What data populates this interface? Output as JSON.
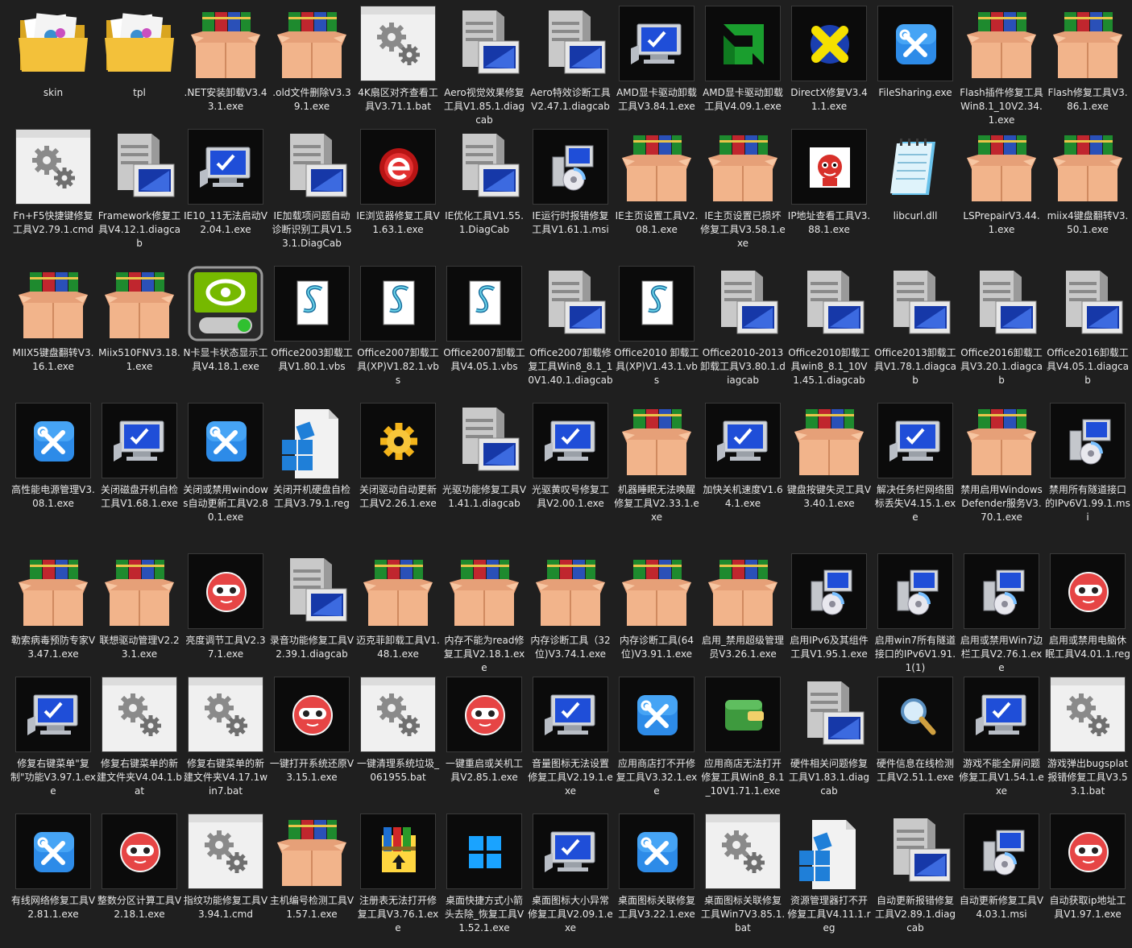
{
  "theme": {
    "background": "#1f1f1f",
    "text": "#e8e8e8",
    "thumb_border": "#3a3a3a"
  },
  "files": [
    {
      "name": "skin",
      "icon": "folder-icon"
    },
    {
      "name": "tpl",
      "icon": "folder-icon"
    },
    {
      "name": ".NET安装卸载V3.43.1.exe",
      "icon": "package-box-icon"
    },
    {
      "name": ".old文件删除V3.39.1.exe",
      "icon": "package-box-icon"
    },
    {
      "name": "4K扇区对齐查看工具V3.71.1.bat",
      "icon": "gear-window-icon"
    },
    {
      "name": "Aero视觉效果修复工具V1.85.1.diagcab",
      "icon": "server-icon"
    },
    {
      "name": "Aero特效诊断工具V2.47.1.diagcab",
      "icon": "server-icon"
    },
    {
      "name": "AMD显卡驱动卸载工具V3.84.1.exe",
      "icon": "monitor-check-icon"
    },
    {
      "name": "AMD显卡驱动卸载工具V4.09.1.exe",
      "icon": "amd-logo-icon"
    },
    {
      "name": "DirectX修复V3.41.1.exe",
      "icon": "directx-icon"
    },
    {
      "name": "FileSharing.exe",
      "icon": "tools-icon"
    },
    {
      "name": "Flash插件修复工具Win8.1_10V2.34.1.exe",
      "icon": "package-box-icon"
    },
    {
      "name": "Flash修复工具V3.86.1.exe",
      "icon": "package-box-icon"
    },
    {
      "name": "Fn+F5快捷键修复工具V2.79.1.cmd",
      "icon": "gear-window-icon"
    },
    {
      "name": "Framework修复工具V4.12.1.diagcab",
      "icon": "server-icon"
    },
    {
      "name": "IE10_11无法启动V2.04.1.exe",
      "icon": "monitor-check-icon"
    },
    {
      "name": "IE加载项问题自动诊断识别工具V1.53.1.DiagCab",
      "icon": "server-icon"
    },
    {
      "name": "IE浏览器修复工具V1.63.1.exe",
      "icon": "red-e-icon"
    },
    {
      "name": "IE优化工具V1.55.1.DiagCab",
      "icon": "server-icon"
    },
    {
      "name": "IE运行时报错修复工具V1.61.1.msi",
      "icon": "installer-icon"
    },
    {
      "name": "IE主页设置工具V2.08.1.exe",
      "icon": "package-box-icon"
    },
    {
      "name": "IE主页设置已损坏修复工具V3.58.1.exe",
      "icon": "package-box-icon"
    },
    {
      "name": "IP地址查看工具V3.88.1.exe",
      "icon": "mascot-icon"
    },
    {
      "name": "libcurl.dll",
      "icon": "notepad-icon"
    },
    {
      "name": "LSPrepairV3.44.1.exe",
      "icon": "package-box-icon"
    },
    {
      "name": "miix4键盘翻转V3.50.1.exe",
      "icon": "package-box-icon"
    },
    {
      "name": "MIIX5键盘翻转V3.16.1.exe",
      "icon": "package-box-icon"
    },
    {
      "name": "Miix510FNV3.18.1.exe",
      "icon": "package-box-icon"
    },
    {
      "name": "N卡显卡状态显示工具V4.18.1.exe",
      "icon": "nvidia-icon"
    },
    {
      "name": "Office2003卸载工具V1.80.1.vbs",
      "icon": "script-icon"
    },
    {
      "name": "Office2007卸载工具(XP)V1.82.1.vbs",
      "icon": "script-icon"
    },
    {
      "name": "Office2007卸载工具V4.05.1.vbs",
      "icon": "script-icon"
    },
    {
      "name": "Office2007卸载修复工具Win8_8.1_10V1.40.1.diagcab",
      "icon": "server-icon"
    },
    {
      "name": "Office2010 卸载工具(XP)V1.43.1.vbs",
      "icon": "script-icon"
    },
    {
      "name": "Office2010-2013卸载工具V3.80.1.diagcab",
      "icon": "server-icon"
    },
    {
      "name": "Office2010卸载工具win8_8.1_10V1.45.1.diagcab",
      "icon": "server-icon"
    },
    {
      "name": "Office2013卸载工具V1.78.1.diagcab",
      "icon": "server-icon"
    },
    {
      "name": "Office2016卸载工具V3.20.1.diagcab",
      "icon": "server-icon"
    },
    {
      "name": "Office2016卸载工具V4.05.1.diagcab",
      "icon": "server-icon"
    },
    {
      "name": "高性能电源管理V3.08.1.exe",
      "icon": "tools-icon"
    },
    {
      "name": "关闭磁盘开机自检工具V1.68.1.exe",
      "icon": "monitor-check-icon"
    },
    {
      "name": "关闭或禁用windows自动更新工具V2.80.1.exe",
      "icon": "tools-icon"
    },
    {
      "name": "关闭开机硬盘自检工具V3.79.1.reg",
      "icon": "registry-icon"
    },
    {
      "name": "关闭驱动自动更新工具V2.26.1.exe",
      "icon": "yellow-gear-icon"
    },
    {
      "name": "光驱功能修复工具V1.41.1.diagcab",
      "icon": "server-icon"
    },
    {
      "name": "光驱黄叹号修复工具V2.00.1.exe",
      "icon": "monitor-check-icon"
    },
    {
      "name": "机器睡眠无法唤醒修复工具V2.33.1.exe",
      "icon": "package-box-icon"
    },
    {
      "name": "加快关机速度V1.64.1.exe",
      "icon": "monitor-check-icon"
    },
    {
      "name": "键盘按键失灵工具V3.40.1.exe",
      "icon": "package-box-icon"
    },
    {
      "name": "解决任务栏网络图标丢失V4.15.1.exe",
      "icon": "monitor-check-icon"
    },
    {
      "name": "禁用启用Windows Defender服务V3.70.1.exe",
      "icon": "package-box-icon"
    },
    {
      "name": "禁用所有隧道接口的IPv6V1.99.1.msi",
      "icon": "installer-icon"
    },
    {
      "name": "勒索病毒预防专家V3.47.1.exe",
      "icon": "package-box-icon"
    },
    {
      "name": "联想驱动管理V2.23.1.exe",
      "icon": "package-box-icon"
    },
    {
      "name": "亮度调节工具V2.37.1.exe",
      "icon": "red-mascot-icon"
    },
    {
      "name": "录音功能修复工具V2.39.1.diagcab",
      "icon": "server-icon"
    },
    {
      "name": "迈克菲卸载工具V1.48.1.exe",
      "icon": "package-box-icon"
    },
    {
      "name": "内存不能为read修复工具V2.18.1.exe",
      "icon": "package-box-icon"
    },
    {
      "name": "内存诊断工具（32位)V3.74.1.exe",
      "icon": "package-box-icon"
    },
    {
      "name": "内存诊断工具(64位)V3.91.1.exe",
      "icon": "package-box-icon"
    },
    {
      "name": "启用_禁用超级管理员V3.26.1.exe",
      "icon": "package-box-icon"
    },
    {
      "name": "启用IPv6及其组件工具V1.95.1.exe",
      "icon": "installer-icon"
    },
    {
      "name": "启用win7所有隧道接口的IPv6V1.91.1(1)",
      "icon": "installer-icon"
    },
    {
      "name": "启用或禁用Win7边栏工具V2.76.1.exe",
      "icon": "installer-icon"
    },
    {
      "name": "启用或禁用电脑休眠工具V4.01.1.reg",
      "icon": "red-mascot-icon"
    },
    {
      "name": "修复右键菜单\"复制\"功能V3.97.1.exe",
      "icon": "monitor-check-icon"
    },
    {
      "name": "修复右键菜单的新建文件夹V4.04.1.bat",
      "icon": "gear-window-icon"
    },
    {
      "name": "修复右键菜单的新建文件夹V4.17.1win7.bat",
      "icon": "gear-window-icon"
    },
    {
      "name": "一键打开系统还原V3.15.1.exe",
      "icon": "red-mascot-icon"
    },
    {
      "name": "一键清理系统垃圾_061955.bat",
      "icon": "gear-window-icon"
    },
    {
      "name": "一键重启或关机工具V2.85.1.exe",
      "icon": "red-mascot-icon"
    },
    {
      "name": "音量图标无法设置修复工具V2.19.1.exe",
      "icon": "monitor-check-icon"
    },
    {
      "name": "应用商店打不开修复工具V3.32.1.exe",
      "icon": "tools-icon"
    },
    {
      "name": "应用商店无法打开修复工具Win8_8.1_10V1.71.1.exe",
      "icon": "wallet-icon"
    },
    {
      "name": "硬件相关问题修复工具V1.83.1.diagcab",
      "icon": "server-icon"
    },
    {
      "name": "硬件信息在线检测工具V2.51.1.exe",
      "icon": "magnifier-icon"
    },
    {
      "name": "游戏不能全屏问题修复工具V1.54.1.exe",
      "icon": "monitor-check-icon"
    },
    {
      "name": "游戏弹出bugsplat报错修复工具V3.53.1.bat",
      "icon": "gear-window-icon"
    },
    {
      "name": "有线网络修复工具V2.81.1.exe",
      "icon": "tools-icon"
    },
    {
      "name": "整数分区计算工具V2.18.1.exe",
      "icon": "red-mascot-icon"
    },
    {
      "name": "指纹功能修复工具V3.94.1.cmd",
      "icon": "gear-window-icon"
    },
    {
      "name": "主机编号检测工具V1.57.1.exe",
      "icon": "package-box-icon"
    },
    {
      "name": "注册表无法打开修复工具V3.76.1.exe",
      "icon": "archive-icon"
    },
    {
      "name": "桌面快捷方式小箭头去除_恢复工具V1.52.1.exe",
      "icon": "windows-logo-icon"
    },
    {
      "name": "桌面图标大小异常修复工具V2.09.1.exe",
      "icon": "monitor-check-icon"
    },
    {
      "name": "桌面图标关联修复工具V3.22.1.exe",
      "icon": "tools-icon"
    },
    {
      "name": "桌面图标关联修复工具Win7V3.85.1.bat",
      "icon": "gear-window-icon"
    },
    {
      "name": "资源管理器打不开修复工具V4.11.1.reg",
      "icon": "registry-icon"
    },
    {
      "name": "自动更新报错修复工具V2.89.1.diagcab",
      "icon": "server-icon"
    },
    {
      "name": "自动更新修复工具V4.03.1.msi",
      "icon": "installer-icon"
    },
    {
      "name": "自动获取ip地址工具V1.97.1.exe",
      "icon": "red-mascot-icon"
    }
  ]
}
